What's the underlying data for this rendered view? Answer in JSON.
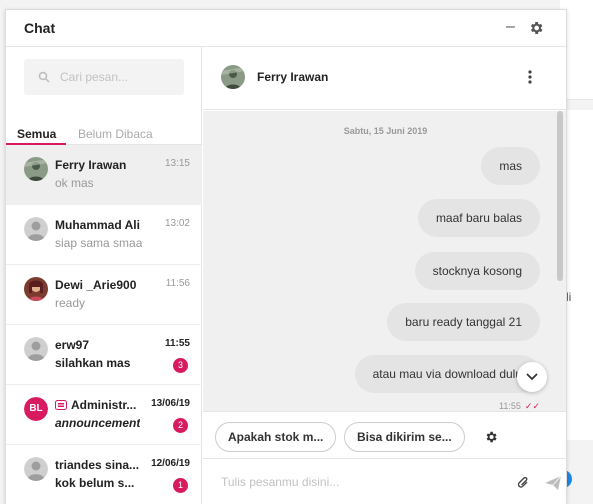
{
  "window": {
    "title": "Chat",
    "minimize_glyph": "–"
  },
  "sidebar": {
    "search_placeholder": "Cari pesan...",
    "tabs": [
      {
        "label": "Semua"
      },
      {
        "label": "Belum Dibaca"
      }
    ],
    "conversations": [
      {
        "name": "Ferry Irawan",
        "preview": "ok mas",
        "time": "13:15"
      },
      {
        "name": "Muhammad Ali",
        "preview": "siap sama smaa",
        "time": "13:02"
      },
      {
        "name": "Dewi _Arie900",
        "preview": "ready",
        "time": "11:56"
      },
      {
        "name": "erw97",
        "preview": "silahkan mas",
        "time": "11:55",
        "badge": "3"
      },
      {
        "initials": "BL",
        "name": "Administr...",
        "preview": "announcement",
        "time": "13/06/19",
        "badge": "2"
      },
      {
        "name": "triandes sina...",
        "preview": "kok belum s...",
        "time": "12/06/19",
        "badge": "1"
      }
    ]
  },
  "chat": {
    "contact_name": "Ferry Irawan",
    "date_separator": "Sabtu, 15 Juni 2019",
    "messages": [
      {
        "text": "mas"
      },
      {
        "text": "maaf baru balas"
      },
      {
        "text": "stocknya kosong"
      },
      {
        "text": "baru ready tanggal 21"
      },
      {
        "text": "atau mau via download dulu"
      }
    ],
    "last_time": "11:55",
    "read_receipt_glyph": "✓✓",
    "quick_replies": [
      {
        "label": "Apakah stok m..."
      },
      {
        "label": "Bisa dikirim se..."
      }
    ],
    "composer_placeholder": "Tulis pesanmu disini..."
  },
  "colors": {
    "accent": "#d81b60",
    "bubble": "#e4e4e4",
    "chat_bg": "#f0f0f0"
  }
}
